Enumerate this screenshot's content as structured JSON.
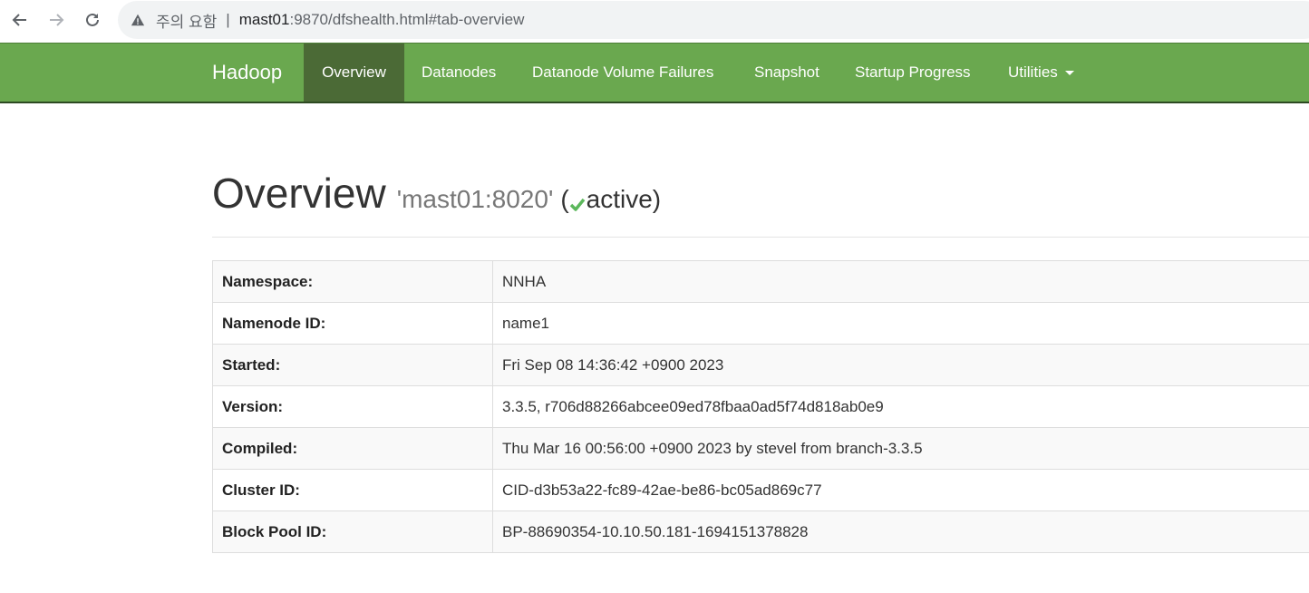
{
  "browser": {
    "warning_text": "주의 요함",
    "separator": "|",
    "url_host": "mast01",
    "url_rest": ":9870/dfshealth.html#tab-overview"
  },
  "navbar": {
    "brand": "Hadoop",
    "items": [
      {
        "label": "Overview",
        "active": true
      },
      {
        "label": "Datanodes"
      },
      {
        "label": "Datanode Volume Failures"
      },
      {
        "label": "Snapshot"
      },
      {
        "label": "Startup Progress"
      },
      {
        "label": "Utilities"
      }
    ]
  },
  "overview": {
    "title": "Overview",
    "address": "'mast01:8020'",
    "paren_open": "(",
    "status": "active",
    "paren_close": ")"
  },
  "info_table": [
    {
      "label": "Namespace:",
      "value": "NNHA"
    },
    {
      "label": "Namenode ID:",
      "value": "name1"
    },
    {
      "label": "Started:",
      "value": "Fri Sep 08 14:36:42 +0900 2023"
    },
    {
      "label": "Version:",
      "value": "3.3.5, r706d88266abcee09ed78fbaa0ad5f74d818ab0e9"
    },
    {
      "label": "Compiled:",
      "value": "Thu Mar 16 00:56:00 +0900 2023 by stevel from branch-3.3.5"
    },
    {
      "label": "Cluster ID:",
      "value": "CID-d3b53a22-fc89-42ae-be86-bc05ad869c77"
    },
    {
      "label": "Block Pool ID:",
      "value": "BP-88690354-10.10.50.181-1694151378828"
    }
  ],
  "colors": {
    "navbar": "#6aa84f",
    "navbar_active": "#4b6a36",
    "check": "#5cb85c"
  }
}
